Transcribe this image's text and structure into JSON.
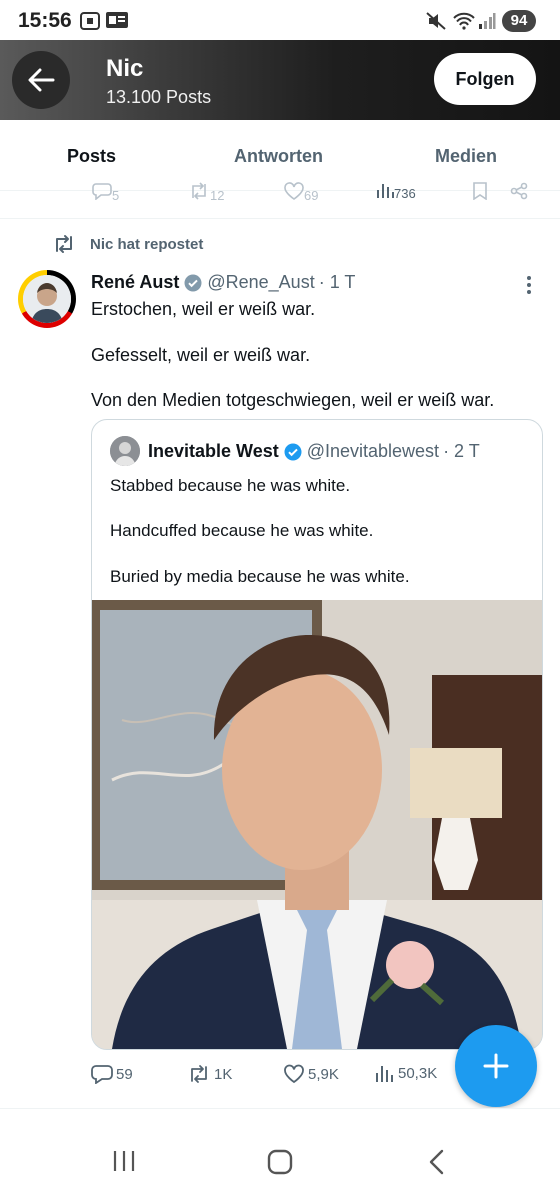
{
  "status_bar": {
    "time": "15:56",
    "battery": "94"
  },
  "header": {
    "title": "Nic",
    "subtitle": "13.100 Posts",
    "follow_label": "Folgen"
  },
  "tabs": [
    {
      "label": "Posts",
      "active": true
    },
    {
      "label": "Antworten",
      "active": false
    },
    {
      "label": "Medien",
      "active": false
    }
  ],
  "prev_post_stats": {
    "replies": "5",
    "reposts": "12",
    "likes": "69",
    "views": "736"
  },
  "post": {
    "repost_label": "Nic hat repostet",
    "author_name": "René Aust",
    "author_handle": "@Rene_Aust",
    "time": "· 1 T",
    "lines": [
      "Erstochen, weil er weiß war.",
      "Gefesselt, weil er weiß war.",
      "Von den Medien totgeschwiegen, weil er weiß war."
    ],
    "quote": {
      "author_name": "Inevitable West",
      "author_handle": "@Inevitablewest",
      "time": "· 2 T",
      "lines": [
        "Stabbed because he was white.",
        "Handcuffed because he was white.",
        "Buried by media because he was white."
      ]
    },
    "stats": {
      "replies": "59",
      "reposts": "1K",
      "likes": "5,9K",
      "views": "50,3K"
    }
  },
  "colors": {
    "accent": "#1d9bf0",
    "text": "#0f1419",
    "muted": "#536471"
  }
}
